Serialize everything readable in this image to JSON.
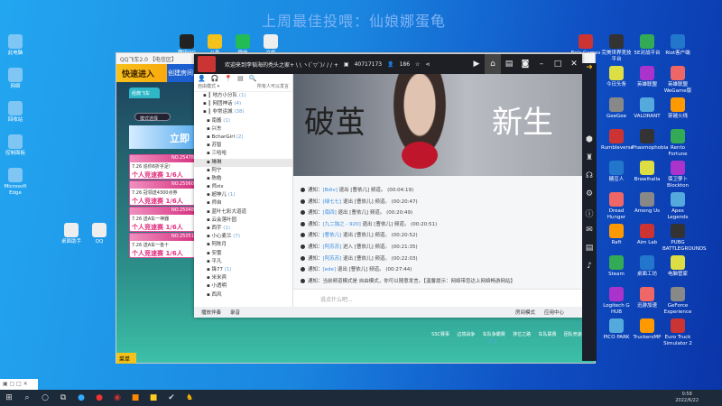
{
  "banner": "上周最佳投喂：仙娘娜蛋龟",
  "desktop_left": [
    "此电脑",
    "网络",
    "回收站",
    "控制面板",
    "Microsoft Edge"
  ],
  "desktop_top": [
    "腾讯QQ",
    "斗鱼",
    "微信",
    "文档"
  ],
  "desktop_mid": [
    "桌面助手",
    "QQ"
  ],
  "desktop_right": [
    "Epic Games",
    "完美世界竞技平台",
    "5E对战平台",
    "Riot客户端",
    "今日头条",
    "英雄联盟",
    "英雄联盟WeGame版",
    "GeeGee",
    "VALORANT",
    "穿越火线",
    "Rumbleverse",
    "Phasmophobia",
    "Rento Fortune",
    "糖豆人",
    "Brawlhalla",
    "保卫萝卜Blockton",
    "Dread Hunger",
    "Among Us",
    "Apex Legends",
    "Raft",
    "Aim Lab",
    "PUBG BATTLEGROUNDS",
    "Steam",
    "桌面工坊",
    "电脑管家",
    "Logitech G HUB",
    "迅游加速",
    "GeForce Experience",
    "PICO PARK",
    "TruckersMP",
    "Euro Truck Simulator 2"
  ],
  "game": {
    "title": "QQ飞车2.0 【电信区】",
    "quick": "快速进入",
    "create": "创建房间",
    "tab": "经典飞车",
    "mode": "模式选择",
    "join": "立即",
    "rooms": [
      {
        "no": "NO.25478",
        "desc": "7.26 追你6折乎足!",
        "type": "个人竞速赛",
        "count": "1/6人"
      },
      {
        "no": "NO.25060",
        "desc": "7.26 冠领送4300点券",
        "type": "个人竞速赛",
        "count": "1/6人"
      },
      {
        "no": "NO.25048",
        "desc": "7.26 送A车一神器",
        "type": "个人竞速赛",
        "count": "1/6人"
      },
      {
        "no": "NO.25051",
        "desc": "7.26 送A车一各十",
        "type": "个人竞速赛",
        "count": "1/6人"
      }
    ],
    "menu": "菜单",
    "page": "1 2",
    "modes": [
      "SSC赛事",
      "边境战争",
      "车队争霸赛",
      "排位之路",
      "车队联赛",
      "团队竞速"
    ]
  },
  "chat": {
    "title": "欢迎来到李韬海的秃头之家+ \\ \\ ヽ(`▽`)ﾉ / / +",
    "room_id": "40717173",
    "viewers": "186",
    "tools": [
      "👤",
      "🎧",
      "📍",
      "▤",
      "🔍"
    ],
    "sort": "自由模式 ▾",
    "sort_right": "所有人可以发言",
    "channels": [
      {
        "name": "地方小分队",
        "count": "(1)",
        "top": true
      },
      {
        "name": "网团神话",
        "count": "(4)",
        "top": true
      },
      {
        "name": "非常运城",
        "count": "(38)",
        "top": true
      },
      {
        "name": "南酱",
        "count": "(1)"
      },
      {
        "name": "兴东",
        "count": ""
      },
      {
        "name": "BcharGirl",
        "count": "(2)"
      },
      {
        "name": "苏智",
        "count": ""
      },
      {
        "name": "三哈哈",
        "count": ""
      },
      {
        "name": "琳琳",
        "count": "",
        "sel": true
      },
      {
        "name": "阿宁",
        "count": ""
      },
      {
        "name": "陈皓",
        "count": ""
      },
      {
        "name": "师zix",
        "count": ""
      },
      {
        "name": "超神儿",
        "count": "(1)"
      },
      {
        "name": "师自",
        "count": ""
      },
      {
        "name": "蓝叶七彩大道道",
        "count": ""
      },
      {
        "name": "云会落叶园",
        "count": ""
      },
      {
        "name": "西宇",
        "count": "(1)"
      },
      {
        "name": "小心麦兰",
        "count": "(7)"
      },
      {
        "name": "阿陈月",
        "count": ""
      },
      {
        "name": "安蕾",
        "count": ""
      },
      {
        "name": "平凡",
        "count": ""
      },
      {
        "name": "锋77",
        "count": "(1)"
      },
      {
        "name": "米米宾",
        "count": ""
      },
      {
        "name": "小透明",
        "count": ""
      },
      {
        "name": "西风",
        "count": ""
      }
    ],
    "video_text": [
      "破茧",
      "新生"
    ],
    "messages": [
      {
        "p": "通知：",
        "n": "[Bdiv]",
        "a": " 退出 [曹依儿] 频道。",
        "t": "(00:04:19)"
      },
      {
        "p": "通知：",
        "n": "[绿七七]",
        "a": " 退出 [曹依儿] 频道。",
        "t": "(00:20:47)"
      },
      {
        "p": "通知：",
        "n": "[南四]",
        "a": " 退出 [曹依儿] 频道。",
        "t": "(00:20:49)"
      },
      {
        "p": "通知：",
        "n": "[九二独之 - 920]",
        "a": " 退出 [曹依儿] 频道。",
        "t": "(00:20:51)"
      },
      {
        "p": "通知：",
        "n": "[曹依儿]",
        "a": " 退出 [曹依儿] 频道。",
        "t": "(00:20:52)"
      },
      {
        "p": "通知：",
        "n": "[阿苏苏]",
        "a": " 进入 [曹依儿] 频道。",
        "t": "(00:21:35)"
      },
      {
        "p": "通知：",
        "n": "[阿苏苏]",
        "a": " 退出 [曹依儿] 频道。",
        "t": "(00:22:03)"
      },
      {
        "p": "通知：",
        "n": "[ede]",
        "a": " 退出 [曹依儿] 频道。",
        "t": "(00:27:44)"
      },
      {
        "p": "通知：",
        "n": "",
        "a": "当前频道模式是 自由模式，你可以随意发言。【温馨提示：网络带您达上网络畅游网站】",
        "t": ""
      }
    ],
    "input_placeholder": "说点什么吧...",
    "bottom": [
      "播放伴奏",
      "录音",
      "房间模式",
      "应用中心"
    ],
    "free_mic": "自由模式"
  },
  "taskbar": {
    "time": "0:58",
    "date": "2022/6/22"
  }
}
